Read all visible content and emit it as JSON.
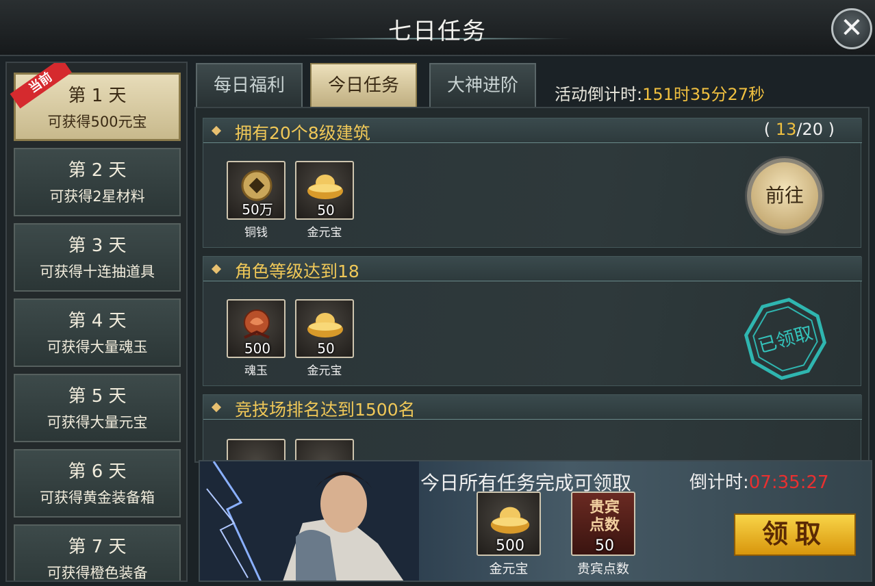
{
  "header": {
    "title": "七日任务"
  },
  "days": [
    {
      "title": "第 1 天",
      "sub": "可获得500元宝",
      "badge": "当前",
      "active": true
    },
    {
      "title": "第 2 天",
      "sub": "可获得2星材料"
    },
    {
      "title": "第 3 天",
      "sub": "可获得十连抽道具"
    },
    {
      "title": "第 4 天",
      "sub": "可获得大量魂玉"
    },
    {
      "title": "第 5 天",
      "sub": "可获得大量元宝"
    },
    {
      "title": "第 6 天",
      "sub": "可获得黄金装备箱"
    },
    {
      "title": "第 7 天",
      "sub": "可获得橙色装备"
    }
  ],
  "tabs": [
    {
      "label": "每日福利"
    },
    {
      "label": "今日任务",
      "active": true
    },
    {
      "label": "大神进阶"
    }
  ],
  "countdown": {
    "label": "活动倒计时:",
    "value": "151时35分27秒"
  },
  "tasks": [
    {
      "name": "拥有20个8级建筑",
      "progress_open": "(",
      "progress_now": "13",
      "progress_total": "/20",
      "progress_close": ")",
      "rewards": [
        {
          "icon": "copper-coin-icon",
          "qty": "50万",
          "name": "铜钱"
        },
        {
          "icon": "gold-ingot-icon",
          "qty": "50",
          "name": "金元宝"
        }
      ],
      "action": "前往"
    },
    {
      "name": "角色等级达到18",
      "rewards": [
        {
          "icon": "soul-jade-icon",
          "qty": "500",
          "name": "魂玉"
        },
        {
          "icon": "gold-ingot-icon",
          "qty": "50",
          "name": "金元宝"
        }
      ],
      "stamp": "已领取"
    },
    {
      "name": "竞技场排名达到1500名",
      "rewards": []
    }
  ],
  "banner": {
    "text": "今日所有任务完成可领取",
    "cd_label": "倒计时:",
    "cd_value": "07:35:27",
    "rewards": [
      {
        "icon": "gold-ingot-icon",
        "qty": "500",
        "name": "金元宝"
      },
      {
        "icon": "vip-points-icon",
        "icon_text_1": "贵宾",
        "icon_text_2": "点数",
        "qty": "50",
        "name": "贵宾点数"
      }
    ],
    "claim_label": "领取"
  },
  "colors": {
    "accent_gold": "#f0c040",
    "task_title": "#f0c858",
    "timer_red": "#e83030"
  }
}
